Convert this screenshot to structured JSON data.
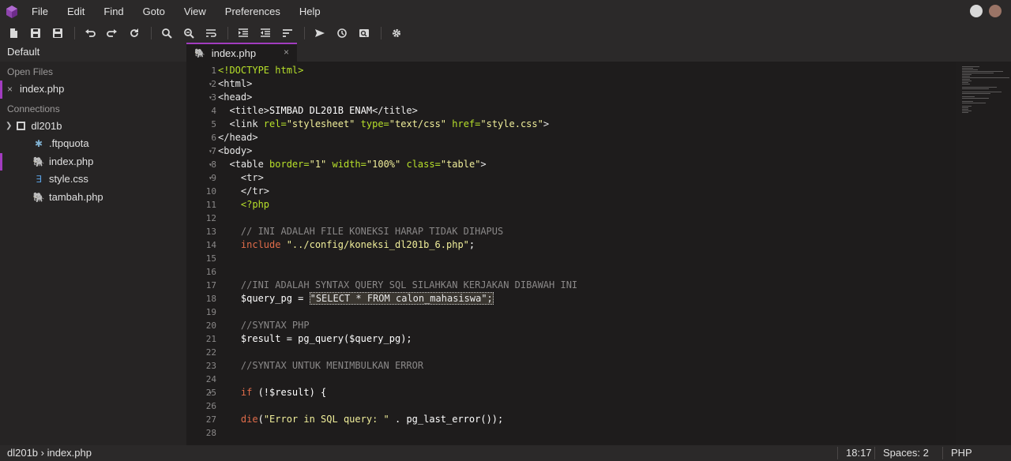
{
  "menubar": {
    "items": [
      "File",
      "Edit",
      "Find",
      "Goto",
      "View",
      "Preferences",
      "Help"
    ]
  },
  "toolbar": {
    "icons": [
      "new-file-icon",
      "save-icon",
      "save-all-icon",
      "undo-icon",
      "redo-icon",
      "reload-icon",
      "search-icon",
      "search-replace-icon",
      "wrap-icon",
      "indent-icon",
      "outdent-icon",
      "sort-icon",
      "send-icon",
      "history-icon",
      "preview-icon",
      "settings-icon"
    ]
  },
  "sidebar": {
    "title": "Default",
    "open_files_label": "Open Files",
    "open_files": [
      {
        "name": "index.php",
        "close": "×"
      }
    ],
    "connections_label": "Connections",
    "connection": {
      "name": "dl201b"
    },
    "files": [
      {
        "name": ".ftpquota",
        "icon": "asterisk-icon",
        "glyph": "✱",
        "color": "#7fb0d0"
      },
      {
        "name": "index.php",
        "icon": "php-elephant-icon",
        "glyph": "🐘",
        "color": "#c36ad8"
      },
      {
        "name": "style.css",
        "icon": "css-icon",
        "glyph": "∃",
        "color": "#5aa0e0"
      },
      {
        "name": "tambah.php",
        "icon": "php-elephant-icon",
        "glyph": "🐘",
        "color": "#c36ad8"
      }
    ]
  },
  "tab": {
    "label": "index.php",
    "close": "×"
  },
  "editor": {
    "line_numbers": [
      "1",
      "2",
      "3",
      "4",
      "5",
      "6",
      "7",
      "8",
      "9",
      "10",
      "11",
      "12",
      "13",
      "14",
      "15",
      "16",
      "17",
      "18",
      "19",
      "20",
      "21",
      "22",
      "23",
      "24",
      "25",
      "26",
      "27",
      "28"
    ],
    "folds": [
      "",
      "▾",
      "▾",
      "",
      "",
      "",
      "▾",
      "▾",
      "▾",
      "",
      "",
      "",
      "",
      "",
      "",
      "",
      "",
      "",
      "",
      "",
      "",
      "",
      "",
      "",
      "▾",
      "",
      "",
      ""
    ],
    "lines": [
      [
        [
          "tgb",
          "<!DOCTYPE html>"
        ]
      ],
      [
        [
          "tg",
          "<html>"
        ]
      ],
      [
        [
          "tg",
          "<head>"
        ]
      ],
      [
        [
          "tg",
          "  <title>"
        ],
        [
          "var",
          "SIMBAD DL201B ENAM"
        ],
        [
          "tg",
          "</title>"
        ]
      ],
      [
        [
          "tg",
          "  <link "
        ],
        [
          "at",
          "rel="
        ],
        [
          "st",
          "\"stylesheet\""
        ],
        [
          "tg",
          " "
        ],
        [
          "at",
          "type="
        ],
        [
          "st",
          "\"text/css\""
        ],
        [
          "tg",
          " "
        ],
        [
          "at",
          "href="
        ],
        [
          "st",
          "\"style.css\""
        ],
        [
          "tg",
          ">"
        ]
      ],
      [
        [
          "tg",
          "</head>"
        ]
      ],
      [
        [
          "tg",
          "<body>"
        ]
      ],
      [
        [
          "tg",
          "  <table "
        ],
        [
          "at",
          "border="
        ],
        [
          "st",
          "\"1\""
        ],
        [
          "tg",
          " "
        ],
        [
          "at",
          "width="
        ],
        [
          "st",
          "\"100%\""
        ],
        [
          "tg",
          " "
        ],
        [
          "at",
          "class="
        ],
        [
          "st",
          "\"table\""
        ],
        [
          "tg",
          ">"
        ]
      ],
      [
        [
          "tg",
          "    <tr>"
        ]
      ],
      [
        [
          "tg",
          "    </tr>"
        ]
      ],
      [
        [
          "tgb",
          "    <?php"
        ]
      ],
      [
        [
          "tg",
          ""
        ]
      ],
      [
        [
          "cm",
          "    // INI ADALAH FILE KONEKSI HARAP TIDAK DIHAPUS"
        ]
      ],
      [
        [
          "kw",
          "    include "
        ],
        [
          "st",
          "\"../config/koneksi_dl201b_6.php\""
        ],
        [
          "var",
          ";"
        ]
      ],
      [
        [
          "tg",
          ""
        ]
      ],
      [
        [
          "tg",
          ""
        ]
      ],
      [
        [
          "cm",
          "    //INI ADALAH SYNTAX QUERY SQL SILAHKAN KERJAKAN DIBAWAH INI"
        ]
      ],
      [
        [
          "var",
          "    $query_pg = "
        ],
        [
          "hl",
          "\"SELECT * FROM calon_mahasiswa\";"
        ]
      ],
      [
        [
          "tg",
          ""
        ]
      ],
      [
        [
          "cm",
          "    //SYNTAX PHP"
        ]
      ],
      [
        [
          "var",
          "    $result = pg_query($query_pg);"
        ]
      ],
      [
        [
          "tg",
          ""
        ]
      ],
      [
        [
          "cm",
          "    //SYNTAX UNTUK MENIMBULKAN ERROR"
        ]
      ],
      [
        [
          "tg",
          ""
        ]
      ],
      [
        [
          "kw",
          "    if "
        ],
        [
          "var",
          "(!$result) {"
        ]
      ],
      [
        [
          "tg",
          ""
        ]
      ],
      [
        [
          "kw",
          "    die"
        ],
        [
          "var",
          "("
        ],
        [
          "st",
          "\"Error in SQL query: \""
        ],
        [
          "var",
          " . pg_last_error());"
        ]
      ],
      [
        [
          "tg",
          ""
        ]
      ]
    ]
  },
  "statusbar": {
    "breadcrumb": "dl201b › index.php",
    "position": "18:17",
    "indent": "Spaces: 2",
    "language": "PHP"
  }
}
